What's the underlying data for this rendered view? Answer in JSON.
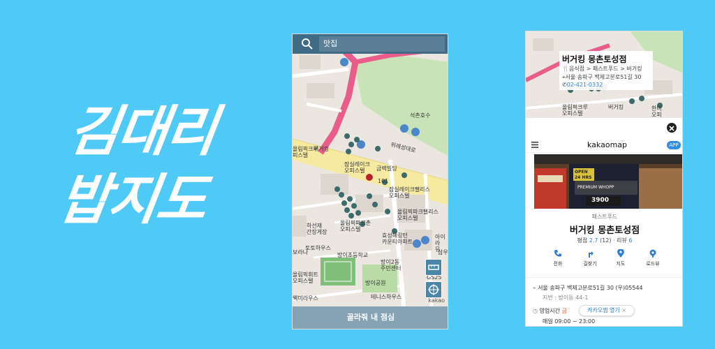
{
  "promo": {
    "title_line1": "김대리",
    "title_line2": "밥지도"
  },
  "screen1": {
    "search_text": "맛집",
    "bottom_button": "골라줘 내 점심",
    "kakao_mark": "kakao",
    "labels": {
      "burger": "버거킹",
      "olympic_crew": "올림픽크루\n피스텔",
      "jamsil": "잠실레이크\n오피스텔",
      "geumbyeok": "금벽빌딩",
      "jamsil_fast": "잠실레이크팰리스\n오피스텔",
      "num101": "101",
      "olympic_park_palace": "올림픽파크팰리스\n오피스텔",
      "olympic_park_cheon": "올림픽파크촌\n오피스텔",
      "hyosung": "효성해링턴\n카운티아파트",
      "hasan": "하선재\n간장게장",
      "toto": "토토하우스",
      "bangi_elem": "방이초등학교",
      "bangi2": "방이2동\n주민센터",
      "bangi_park": "방이공원",
      "olympic_hwi": "올림픽휘트\n오피스텔",
      "tennis": "테니스하우스",
      "seollip": "석촌호수",
      "yongsan": "위례성대로",
      "aira": "아이라\n뮤",
      "sangu": "삼우",
      "gs25": "GS25",
      "curry": "커리스",
      "ehraji": "보라나",
      "woodhouse": "웩미라우스",
      "hanmi": "한미\n카"
    }
  },
  "screen2": {
    "place_title": "버거킹 몽촌토성점",
    "category_path": "음식점 > 패스트푸드 > 버거킹",
    "short_address": "서울 송파구 백제고분로51길 30",
    "phone": "02-421-0332",
    "map_labels": {
      "burger": "버거킹",
      "olympic_crew": "올림픽크루\n오피스텔",
      "han": "한미\n오피"
    },
    "header_logo": "kakaomap",
    "app_badge": "APP",
    "category": "패스트푸드",
    "place_name": "버거킹 몽촌토성점",
    "rating_label": "평점",
    "rating_value": "2.7",
    "rating_count": "(12)",
    "review_label": "리뷰",
    "review_count": "6",
    "actions": [
      "전화",
      "길찾기",
      "지도",
      "로드뷰"
    ],
    "full_address": "서울 송파구 백제고분로51길 30 (우)05544",
    "jibun": "지번 : 방이동 44-1",
    "hours_label": "영업시간",
    "hours_status": "금",
    "open_kakao": "카카오맵 열기",
    "hours": "매일 09:00 ~ 23:00",
    "photo_text1": "OPEN",
    "photo_text2": "24 HRS",
    "photo_text3": "PREMIUM WHOPP",
    "photo_text4": "3900"
  },
  "colors": {
    "background": "#4fc9f6",
    "topbar": "#3f6b86",
    "bottombar": "#85a3b4",
    "marker": "#3d6b6c",
    "link": "#2a7fd4"
  }
}
